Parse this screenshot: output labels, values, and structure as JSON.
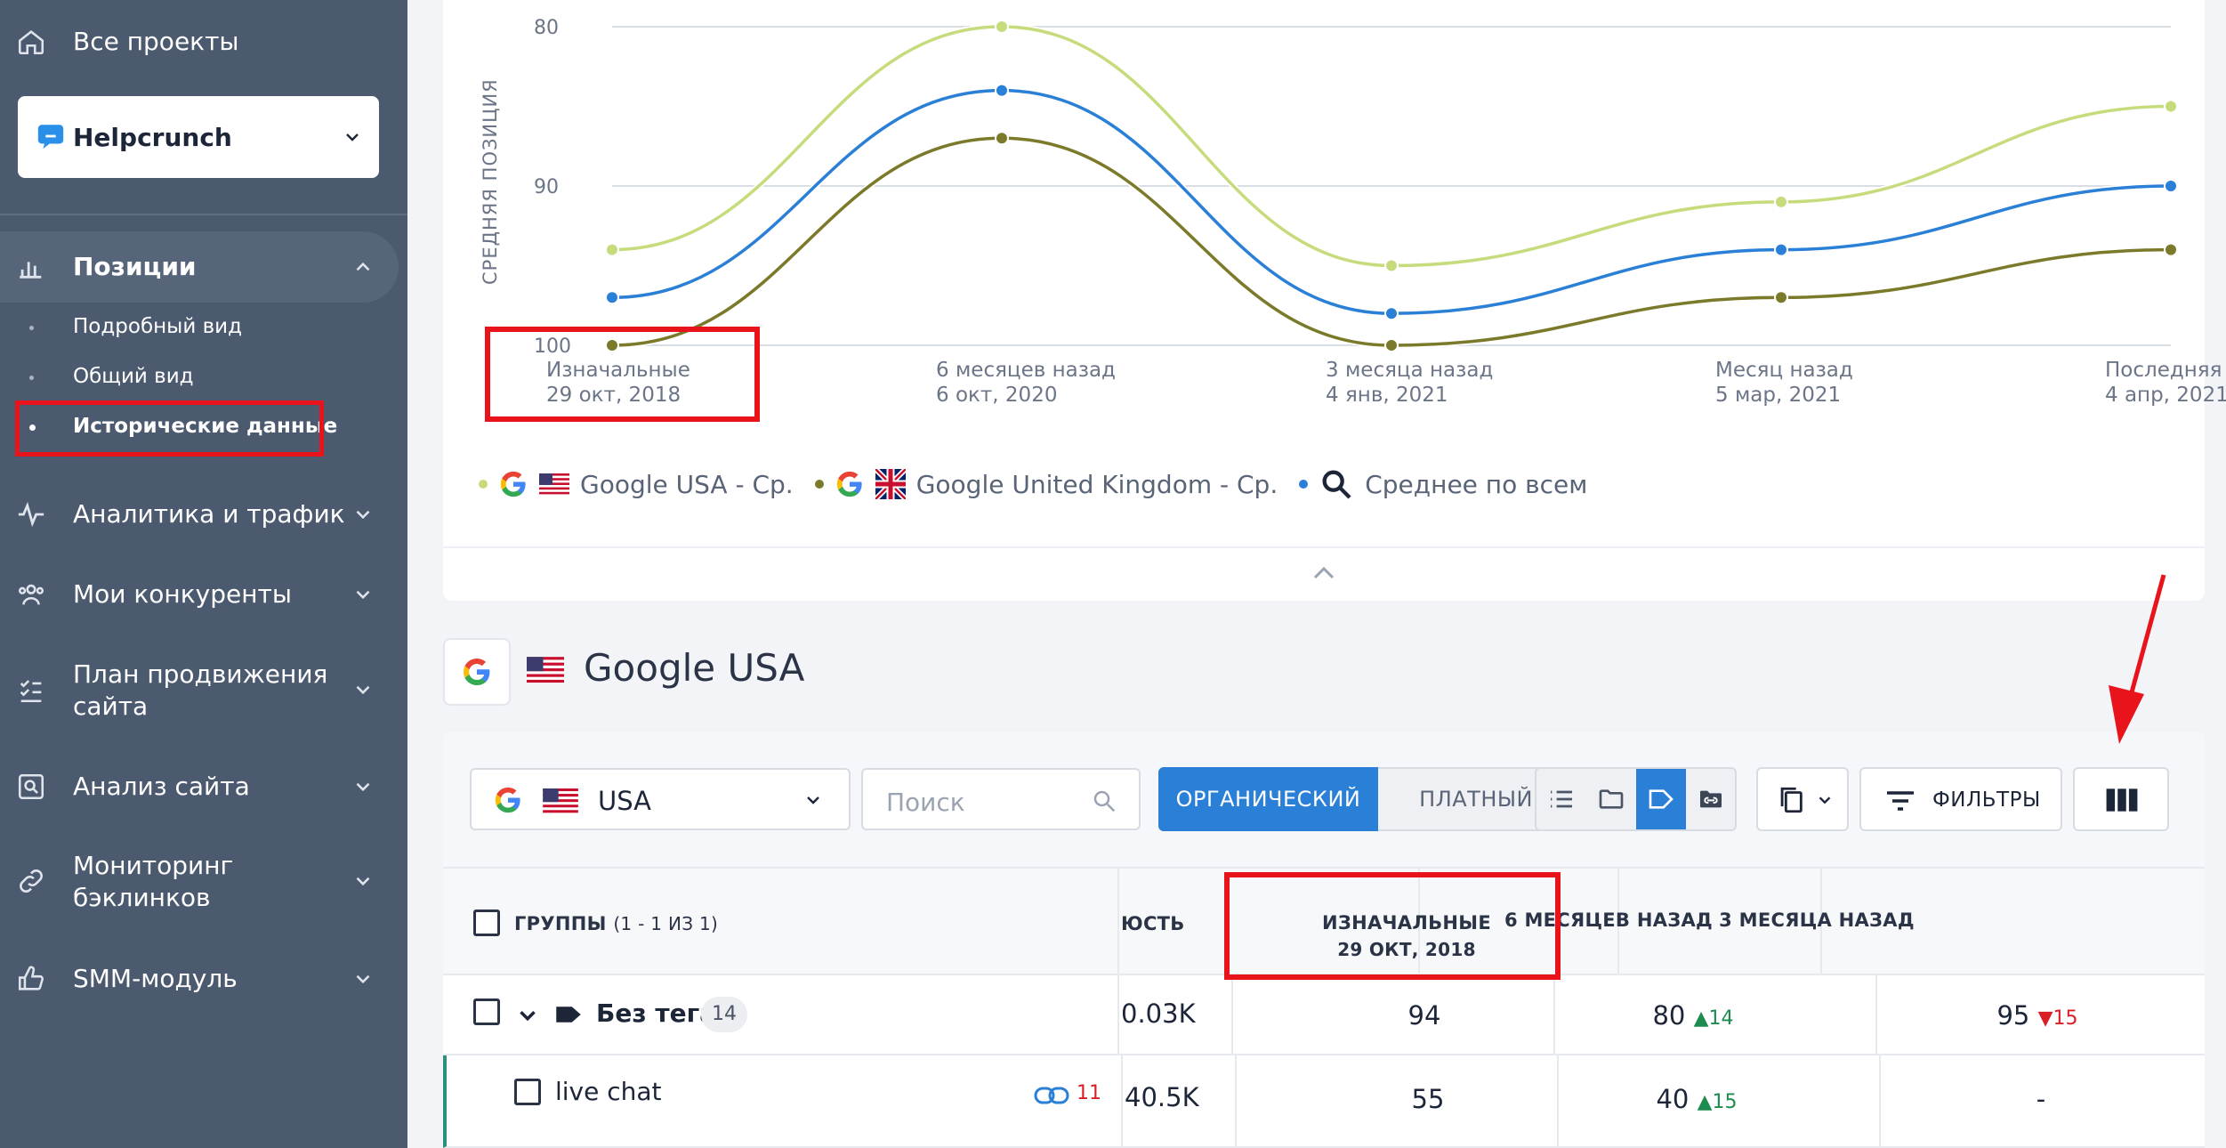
{
  "sidebar": {
    "all_projects": "Все проекты",
    "project": "Helpcrunch",
    "positions": "Позиции",
    "sub_detailed": "Подробный вид",
    "sub_general": "Общий вид",
    "sub_history": "Исторические данные",
    "analytics": "Аналитика и трафик",
    "competitors": "Мои конкуренты",
    "plan_line1": "План продвижения",
    "plan_line2": "сайта",
    "site_analysis": "Анализ сайта",
    "backlinks_line1": "Мониторинг",
    "backlinks_line2": "бэклинков",
    "smm": "SMM-модуль"
  },
  "chart_data": {
    "type": "line",
    "ylabel": "СРЕДНЯЯ ПОЗИЦИЯ",
    "ylim": [
      100,
      80
    ],
    "y_inverted": true,
    "y_ticks": [
      "80",
      "90",
      "100"
    ],
    "x_labels": [
      {
        "line1": "Изначальные",
        "line2": "29 окт, 2018"
      },
      {
        "line1": "6 месяцев назад",
        "line2": "6 окт, 2020"
      },
      {
        "line1": "3 месяца назад",
        "line2": "4 янв, 2021"
      },
      {
        "line1": "Месяц назад",
        "line2": "5 мар, 2021"
      },
      {
        "line1": "Последняя пров",
        "line2": "4 апр, 2021"
      }
    ],
    "series": [
      {
        "name": "Google USA - Ср.",
        "color": "#c6dc7c",
        "values": [
          94,
          80,
          95,
          91,
          85
        ]
      },
      {
        "name": "Google United Kingdom - Ср.",
        "color": "#7a7a2a",
        "values": [
          100,
          87,
          100,
          97,
          94
        ]
      },
      {
        "name": "Среднее по всем",
        "color": "#2a7fd6",
        "values": [
          97,
          84,
          98,
          94,
          90
        ]
      }
    ]
  },
  "legend": {
    "usa": "Google USA - Ср.",
    "uk": "Google United Kingdom - Ср.",
    "avg": "Среднее по всем"
  },
  "section": {
    "title": "Google USA"
  },
  "toolbar": {
    "country": "USA",
    "search_placeholder": "Поиск",
    "organic": "ОРГАНИЧЕСКИЙ",
    "paid": "ПЛАТНЫЙ",
    "filters": "ФИЛЬТРЫ"
  },
  "table": {
    "groups_label": "ГРУППЫ",
    "groups_count": "(1 - 1 ИЗ 1)",
    "col_freq": "ЮСТЬ",
    "col_initial": "ИЗНАЧАЛЬНЫЕ",
    "col_initial_date": "29 ОКТ, 2018",
    "col_6m": "6 МЕСЯЦЕВ НАЗАД",
    "col_3m": "3 МЕСЯЦА НАЗАД",
    "rows": [
      {
        "name": "Без тега",
        "badge": "14",
        "freq": "0.03K",
        "initial": "94",
        "m6": "80",
        "m6_delta": "14",
        "m3": "95",
        "m3_delta": "15"
      },
      {
        "name": "live chat",
        "links": "11",
        "freq": "40.5K",
        "initial": "55",
        "m6": "40",
        "m6_delta": "15",
        "m3": "-"
      }
    ]
  },
  "colors": {
    "accent": "#2a7fd6",
    "sidebar": "#4b5a6f",
    "highlight": "#e8131b"
  }
}
